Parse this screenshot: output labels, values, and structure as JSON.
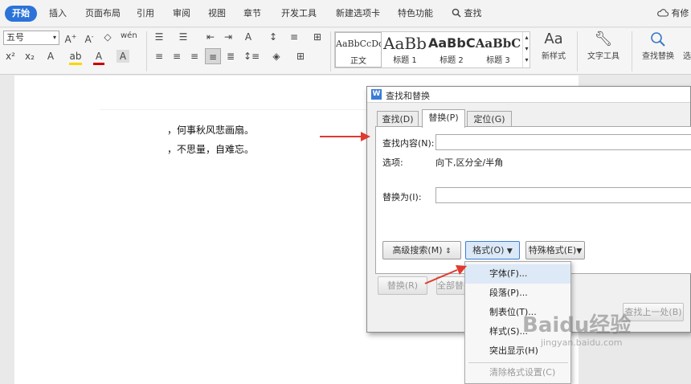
{
  "menubar": {
    "tabs": [
      "开始",
      "插入",
      "页面布局",
      "引用",
      "审阅",
      "视图",
      "章节",
      "开发工具",
      "新建选项卡",
      "特色功能"
    ],
    "search_label": "查找",
    "right_text": "有修"
  },
  "ribbon": {
    "font_size": "五号",
    "styles": [
      {
        "preview": "AaBbCcDd",
        "name": "正文"
      },
      {
        "preview": "AaBb",
        "name": "标题 1"
      },
      {
        "preview": "AaBbC",
        "name": "标题 2"
      },
      {
        "preview": "AaBbC",
        "name": "标题 3"
      }
    ],
    "new_style": "新样式",
    "text_tools": "文字工具",
    "find_replace": "查找替换",
    "select_partial": "选"
  },
  "document": {
    "lines": [
      "，何事秋风悲画扇。",
      "，不思量，自难忘。"
    ]
  },
  "dialog": {
    "title": "查找和替换",
    "tabs": [
      "查找(D)",
      "替换(P)",
      "定位(G)"
    ],
    "find_label": "查找内容(N):",
    "find_value": "",
    "options_label": "选项:",
    "options_value": "向下,区分全/半角",
    "replace_label": "替换为(I):",
    "replace_value": "",
    "advanced_button": "高级搜索(M)",
    "format_button": "格式(O)",
    "special_button": "特殊格式(E)",
    "replace_button": "替换(R)",
    "replace_all_button": "全部替换(A)",
    "find_prev_button": "查找上一处(B)"
  },
  "format_menu": {
    "items": [
      "字体(F)...",
      "段落(P)...",
      "制表位(T)...",
      "样式(S)...",
      "突出显示(H)",
      "清除格式设置(C)"
    ]
  },
  "watermark": {
    "brand": "Baidu经验",
    "url": "jingyan.baidu.com"
  },
  "colors": {
    "accent": "#2b73d9",
    "arrow": "#e03a2e",
    "highlight": "#dde9f7"
  }
}
